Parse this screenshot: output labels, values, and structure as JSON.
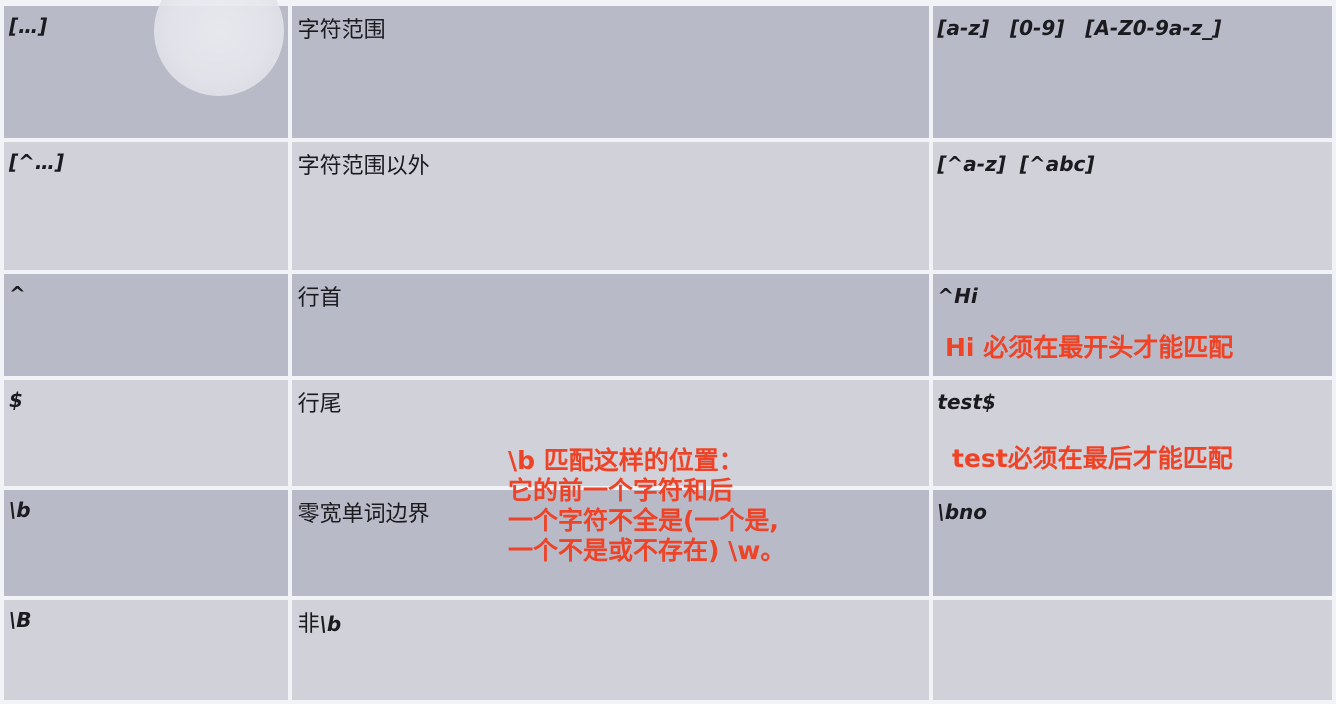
{
  "rows": [
    {
      "symbol": "[…]",
      "description": "字符范围",
      "example": "[a-z]   [0-9]   [A-Z0-9a-z_]"
    },
    {
      "symbol": "[^…]",
      "description": "字符范围以外",
      "example": "[^a-z]  [^abc]"
    },
    {
      "symbol": "^",
      "description": "行首",
      "example": "^Hi"
    },
    {
      "symbol": "$",
      "description": "行尾",
      "example": "test$"
    },
    {
      "symbol": "\\b",
      "description": "零宽单词边界",
      "example": "\\bno"
    },
    {
      "symbol": "\\B",
      "description_prefix": "非",
      "description_symbol": "\\b",
      "example": ""
    }
  ],
  "annotations": {
    "hi_note": "Hi 必须在最开头才能匹配",
    "test_note": "test必须在最后才能匹配",
    "b_note": [
      "\\b 匹配这样的位置：",
      "它的前一个字符和后",
      "一个字符不全是(一个是,",
      "一个不是或不存在) \\w。"
    ]
  },
  "colors": {
    "row_dark": "#b8bac8",
    "row_light": "#d0d1d9",
    "annotation": "#ee4326",
    "text": "#1a1a1f"
  }
}
